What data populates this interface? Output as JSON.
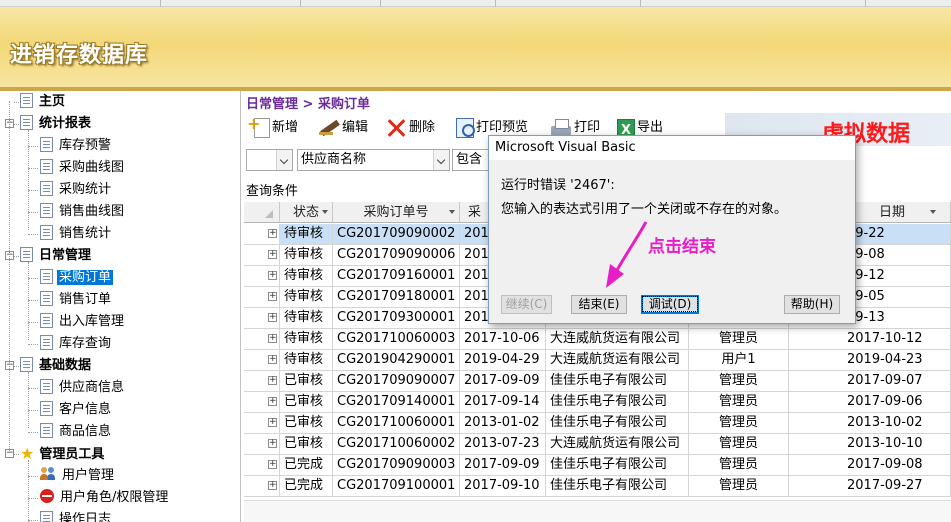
{
  "app_title": "进销存数据库",
  "nav": {
    "items": [
      {
        "label": "主页",
        "type": "group"
      },
      {
        "label": "统计报表",
        "type": "group"
      },
      {
        "label": "库存预警",
        "type": "item"
      },
      {
        "label": "采购曲线图",
        "type": "item"
      },
      {
        "label": "采购统计",
        "type": "item"
      },
      {
        "label": "销售曲线图",
        "type": "item"
      },
      {
        "label": "销售统计",
        "type": "item"
      },
      {
        "label": "日常管理",
        "type": "group"
      },
      {
        "label": "采购订单",
        "type": "item",
        "selected": true
      },
      {
        "label": "销售订单",
        "type": "item"
      },
      {
        "label": "出入库管理",
        "type": "item"
      },
      {
        "label": "库存查询",
        "type": "item"
      },
      {
        "label": "基础数据",
        "type": "group"
      },
      {
        "label": "供应商信息",
        "type": "item"
      },
      {
        "label": "客户信息",
        "type": "item"
      },
      {
        "label": "商品信息",
        "type": "item"
      },
      {
        "label": "管理员工具",
        "type": "group",
        "icon": "star-icon"
      },
      {
        "label": "用户管理",
        "type": "item",
        "icon": "users-icon"
      },
      {
        "label": "用户角色/权限管理",
        "type": "item",
        "icon": "no-entry-icon"
      },
      {
        "label": "操作日志",
        "type": "item"
      }
    ]
  },
  "breadcrumb": "日常管理 > 采购订单",
  "toolbar": {
    "new": "新增",
    "edit": "编辑",
    "delete": "删除",
    "print_preview": "打印预览",
    "print": "打印",
    "export": "导出"
  },
  "watermark": "虚拟数据",
  "filter": {
    "field1_value": "",
    "field2_value": "供应商名称",
    "op_value": "包含",
    "query_label": "查询条件"
  },
  "grid": {
    "columns": [
      "状态",
      "采购订单号",
      "采",
      "",
      "",
      "日期"
    ],
    "rows": [
      {
        "status": "待审核",
        "order_no": "CG201709090002",
        "date": "201",
        "supplier": "",
        "user": "",
        "date2": "09-22",
        "selected": true
      },
      {
        "status": "待审核",
        "order_no": "CG201709090006",
        "date": "201",
        "supplier": "",
        "user": "",
        "date2": "09-08"
      },
      {
        "status": "待审核",
        "order_no": "CG201709160001",
        "date": "201",
        "supplier": "",
        "user": "",
        "date2": "09-12"
      },
      {
        "status": "待审核",
        "order_no": "CG201709180001",
        "date": "201",
        "supplier": "",
        "user": "",
        "date2": "09-05"
      },
      {
        "status": "待审核",
        "order_no": "CG201709300001",
        "date": "201",
        "supplier": "",
        "user": "",
        "date2": "09-13"
      },
      {
        "status": "待审核",
        "order_no": "CG201710060003",
        "date": "2017-10-06",
        "supplier": "大连威航货运有限公司",
        "user": "管理员",
        "date2": "2017-10-12"
      },
      {
        "status": "待审核",
        "order_no": "CG201904290001",
        "date": "2019-04-29",
        "supplier": "大连威航货运有限公司",
        "user": "用户1",
        "date2": "2019-04-23"
      },
      {
        "status": "已审核",
        "order_no": "CG201709090007",
        "date": "2017-09-09",
        "supplier": "佳佳乐电子有限公司",
        "user": "管理员",
        "date2": "2017-09-07"
      },
      {
        "status": "已审核",
        "order_no": "CG201709140001",
        "date": "2017-09-14",
        "supplier": "佳佳乐电子有限公司",
        "user": "管理员",
        "date2": "2017-09-06"
      },
      {
        "status": "已审核",
        "order_no": "CG201710060001",
        "date": "2013-01-02",
        "supplier": "佳佳乐电子有限公司",
        "user": "管理员",
        "date2": "2013-10-02"
      },
      {
        "status": "已审核",
        "order_no": "CG201710060002",
        "date": "2013-07-23",
        "supplier": "大连威航货运有限公司",
        "user": "管理员",
        "date2": "2013-10-10"
      },
      {
        "status": "已完成",
        "order_no": "CG201709090003",
        "date": "2017-09-09",
        "supplier": "佳佳乐电子有限公司",
        "user": "管理员",
        "date2": "2017-09-08"
      },
      {
        "status": "已完成",
        "order_no": "CG201709100001",
        "date": "2017-09-10",
        "supplier": "佳佳乐电子有限公司",
        "user": "管理员",
        "date2": "2017-09-27"
      }
    ]
  },
  "dialog": {
    "title": "Microsoft Visual Basic",
    "error_line": "运行时错误 '2467':",
    "message": "您输入的表达式引用了一个关闭或不存在的对象。",
    "btn_continue": "继续(C)",
    "btn_end": "结束(E)",
    "btn_debug": "调试(D)",
    "btn_help": "帮助(H)"
  },
  "annotation": "点击结束",
  "colors": {
    "annotation": "#e61ec8",
    "watermark": "#ff1a1a",
    "breadcrumb": "#6a2a9a",
    "selection": "#0078d7"
  }
}
